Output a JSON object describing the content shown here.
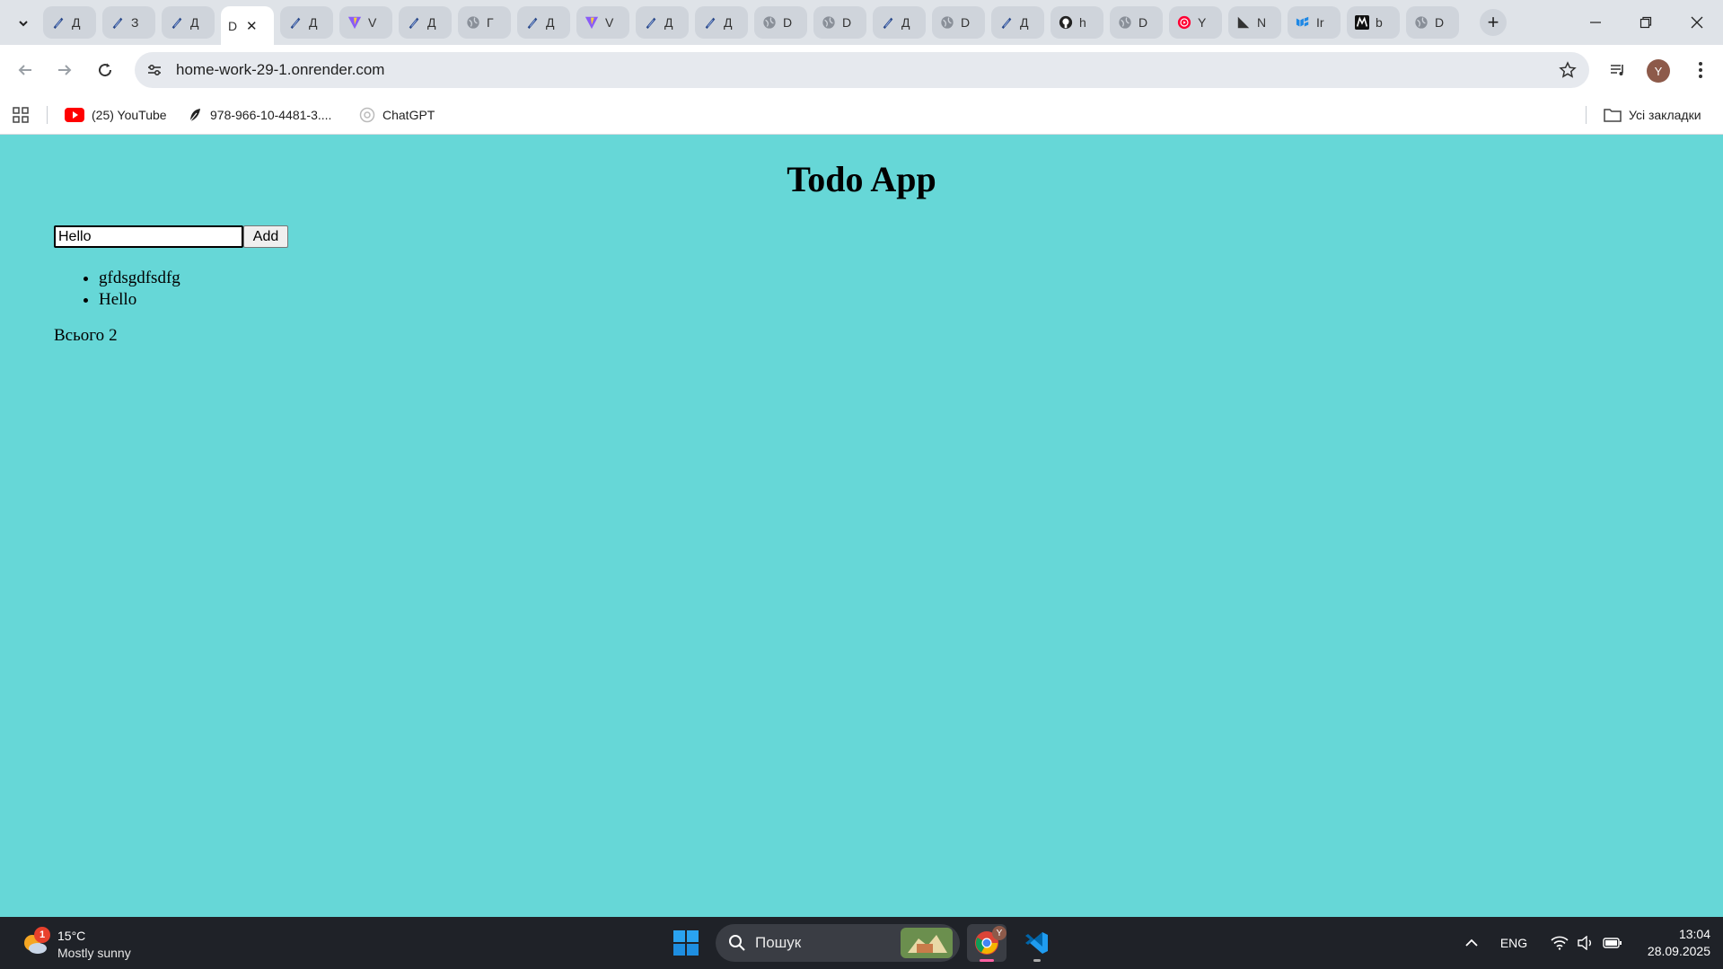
{
  "browser": {
    "tabs": [
      {
        "title": "Д",
        "icon": "feather-icon"
      },
      {
        "title": "З",
        "icon": "feather-icon"
      },
      {
        "title": "Д",
        "icon": "feather-icon"
      },
      {
        "title": "D",
        "icon": "none",
        "active": true
      },
      {
        "title": "Д",
        "icon": "feather-icon"
      },
      {
        "title": "V",
        "icon": "vite-icon"
      },
      {
        "title": "Д",
        "icon": "feather-icon"
      },
      {
        "title": "Г",
        "icon": "globe-icon"
      },
      {
        "title": "Д",
        "icon": "feather-icon"
      },
      {
        "title": "V",
        "icon": "vite-icon"
      },
      {
        "title": "Д",
        "icon": "feather-icon"
      },
      {
        "title": "Д",
        "icon": "feather-icon"
      },
      {
        "title": "D",
        "icon": "globe-icon"
      },
      {
        "title": "D",
        "icon": "globe-icon"
      },
      {
        "title": "Д",
        "icon": "feather-icon"
      },
      {
        "title": "D",
        "icon": "globe-icon"
      },
      {
        "title": "Д",
        "icon": "feather-icon"
      },
      {
        "title": "h",
        "icon": "github-icon"
      },
      {
        "title": "D",
        "icon": "globe-icon"
      },
      {
        "title": "Y",
        "icon": "youtube-music-icon"
      },
      {
        "title": "N",
        "icon": "triangle-icon"
      },
      {
        "title": "Ir",
        "icon": "mui-icon"
      },
      {
        "title": "b",
        "icon": "m-logo-icon"
      },
      {
        "title": "D",
        "icon": "globe-icon"
      }
    ],
    "url": "home-work-29-1.onrender.com",
    "profile_initial": "Y"
  },
  "bookmarks": {
    "items": [
      {
        "label": "(25) YouTube",
        "icon": "youtube-icon"
      },
      {
        "label": "978-966-10-4481-3....",
        "icon": "leaf-icon"
      },
      {
        "label": "ChatGPT",
        "icon": "chatgpt-icon"
      }
    ],
    "all_bookmarks_label": "Усі закладки"
  },
  "page": {
    "title": "Todo App",
    "input_value": "Hello",
    "add_label": "Add",
    "todos": [
      "gfdsgdfsdfg",
      "Hello"
    ],
    "total_label": "Всього",
    "total_count": "2",
    "background_color": "#66d7d7"
  },
  "taskbar": {
    "weather_badge": "1",
    "temperature": "15°C",
    "condition": "Mostly sunny",
    "search_placeholder": "Пошук",
    "chrome_badge": "Y",
    "language": "ENG",
    "time": "13:04",
    "date": "28.09.2025"
  }
}
